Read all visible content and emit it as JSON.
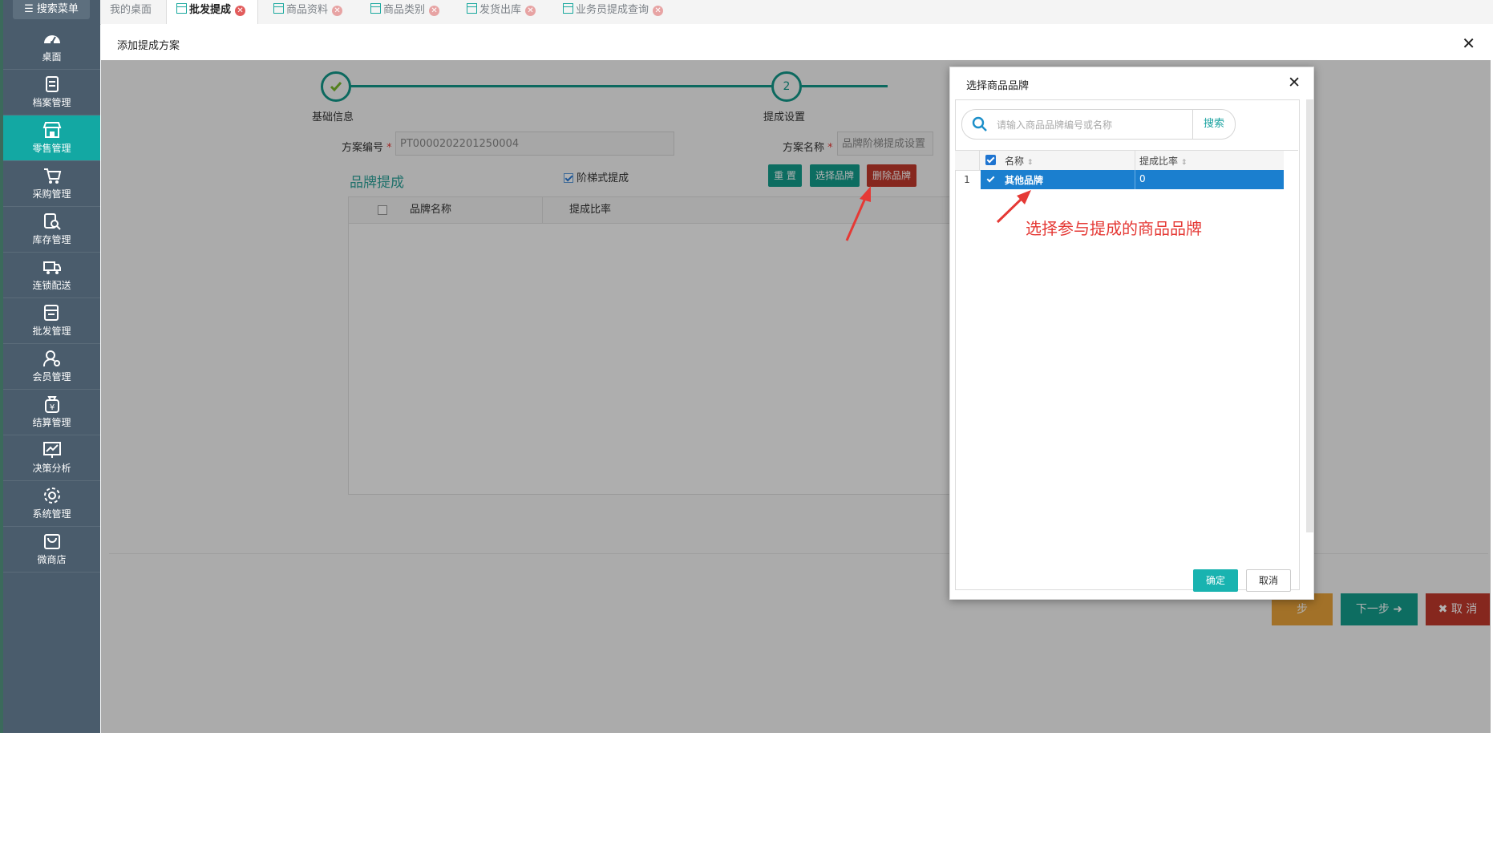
{
  "sidebar": {
    "search_label": "搜索菜单",
    "items": [
      {
        "label": "桌面"
      },
      {
        "label": "档案管理"
      },
      {
        "label": "零售管理"
      },
      {
        "label": "采购管理"
      },
      {
        "label": "库存管理"
      },
      {
        "label": "连锁配送"
      },
      {
        "label": "批发管理"
      },
      {
        "label": "会员管理"
      },
      {
        "label": "结算管理"
      },
      {
        "label": "决策分析"
      },
      {
        "label": "系统管理"
      },
      {
        "label": "微商店"
      }
    ]
  },
  "tabs": [
    {
      "label": "我的桌面"
    },
    {
      "label": "批发提成"
    },
    {
      "label": "商品资料"
    },
    {
      "label": "商品类别"
    },
    {
      "label": "发货出库"
    },
    {
      "label": "业务员提成查询"
    }
  ],
  "page": {
    "title": "添加提成方案",
    "steps": [
      {
        "label": "基础信息"
      },
      {
        "label": "提成设置"
      }
    ],
    "step2_number": "2",
    "scheme_no_label": "方案编号",
    "scheme_no_value": "PT0000202201250004",
    "scheme_name_label": "方案名称",
    "scheme_name_value": "品牌阶梯提成设置",
    "required_mark": "*",
    "section_title": "品牌提成",
    "tiered_label": "阶梯式提成",
    "btn_reset": "重 置",
    "btn_select_brand": "选择品牌",
    "btn_delete_brand": "删除品牌",
    "col_brand_name": "品牌名称",
    "col_rate": "提成比率",
    "btn_prev": "步",
    "btn_next": "下一步",
    "btn_cancel": "取 消"
  },
  "modal": {
    "title": "选择商品品牌",
    "search_placeholder": "请输入商品品牌编号或名称",
    "search_button": "搜索",
    "col_name": "名称",
    "col_rate": "提成比率",
    "rows": [
      {
        "num": "1",
        "name": "其他品牌",
        "rate": "0"
      }
    ],
    "confirm": "确定",
    "cancel": "取消"
  },
  "annotation": "选择参与提成的商品品牌",
  "colors": {
    "sidebar": "#4a5c6c",
    "accent": "#13a8a3",
    "danger": "#c0392b",
    "annotation": "#e53935",
    "selected_row": "#1b7fcf"
  }
}
